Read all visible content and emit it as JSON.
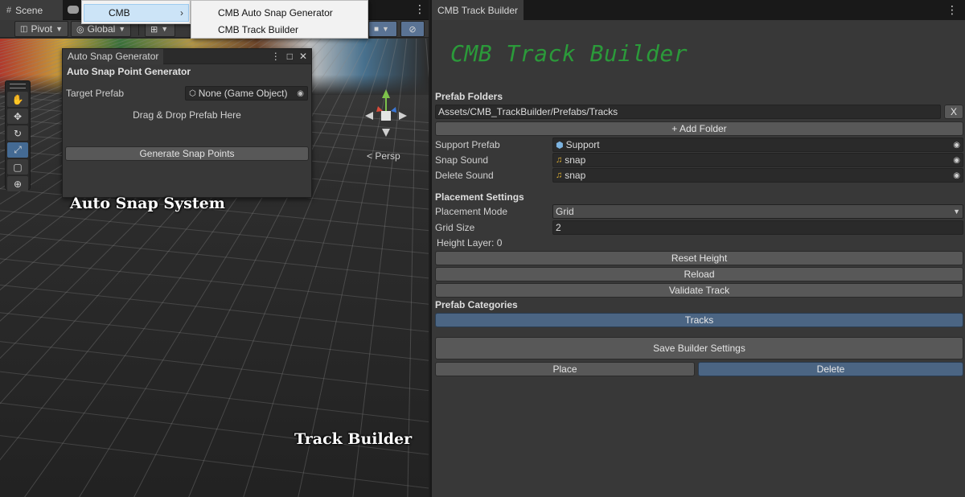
{
  "scene": {
    "tab_label": "Scene",
    "toolbar": {
      "pivot_label": "Pivot",
      "global_label": "Global"
    },
    "persp_label": "< Persp",
    "captions": {
      "auto_snap": "Auto Snap System",
      "track_builder": "Track Builder"
    }
  },
  "context_menu": {
    "root_item": "CMB",
    "submenu": [
      "CMB Auto Snap Generator",
      "CMB Track Builder"
    ]
  },
  "snap_window": {
    "tab_label": "Auto Snap Generator",
    "heading": "Auto Snap Point Generator",
    "target_label": "Target Prefab",
    "target_value": "None (Game Object)",
    "drop_text": "Drag & Drop Prefab Here",
    "generate_label": "Generate Snap Points"
  },
  "builder": {
    "tab_label": "CMB Track Builder",
    "title": "CMB Track Builder",
    "title_color": "#2b9a3a",
    "prefab_folders_label": "Prefab Folders",
    "folder_path": "Assets/CMB_TrackBuilder/Prefabs/Tracks",
    "remove_label": "X",
    "add_folder_label": "+ Add Folder",
    "support_prefab_label": "Support Prefab",
    "support_prefab_value": "Support",
    "snap_sound_label": "Snap Sound",
    "snap_sound_value": "snap",
    "delete_sound_label": "Delete Sound",
    "delete_sound_value": "snap",
    "placement_settings_label": "Placement Settings",
    "placement_mode_label": "Placement Mode",
    "placement_mode_value": "Grid",
    "grid_size_label": "Grid Size",
    "grid_size_value": "2",
    "height_layer_text": "Height Layer: 0",
    "reset_height_label": "Reset Height",
    "reload_label": "Reload",
    "validate_label": "Validate Track",
    "categories_label": "Prefab Categories",
    "category_tracks": "Tracks",
    "save_label": "Save Builder Settings",
    "place_label": "Place",
    "delete_label": "Delete"
  }
}
